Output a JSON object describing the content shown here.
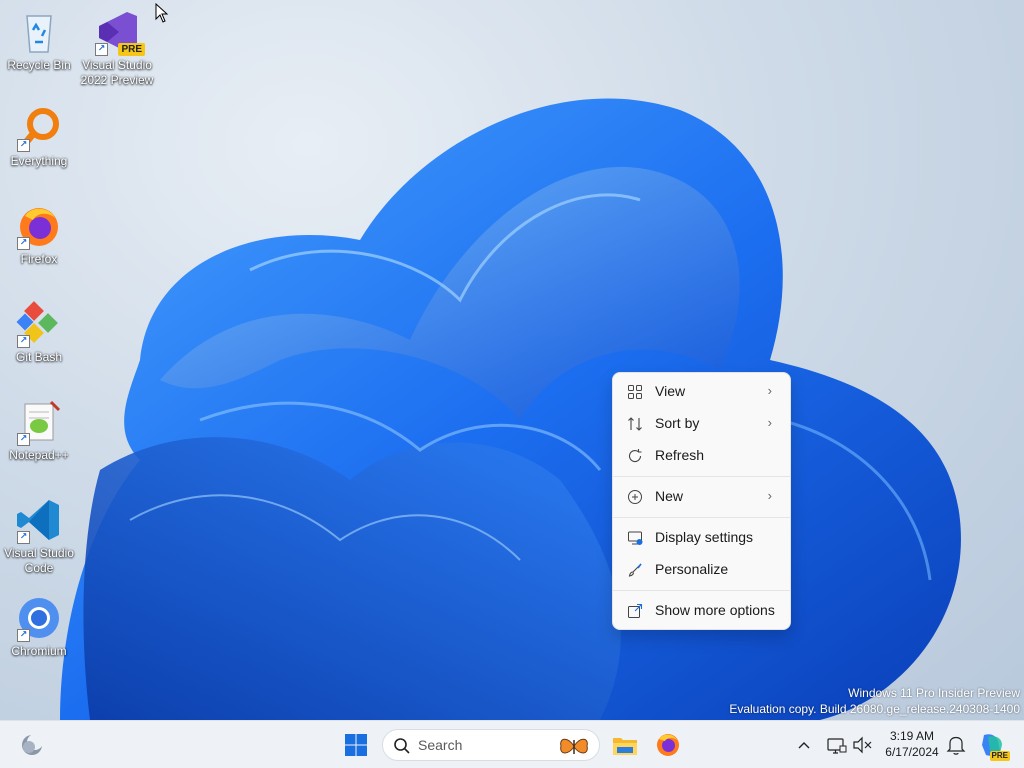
{
  "desktop": {
    "icons": [
      {
        "label": "Recycle Bin",
        "icon": "recycle-bin-icon"
      },
      {
        "label": "Visual Studio\n2022 Preview",
        "icon": "visual-studio-preview-icon",
        "badge": "PRE"
      },
      {
        "label": "Everything",
        "icon": "everything-search-icon"
      },
      {
        "label": "Firefox",
        "icon": "firefox-icon"
      },
      {
        "label": "Git Bash",
        "icon": "git-bash-icon"
      },
      {
        "label": "Notepad++",
        "icon": "notepad-plus-plus-icon"
      },
      {
        "label": "Visual Studio\nCode",
        "icon": "vscode-icon"
      },
      {
        "label": "Chromium",
        "icon": "chromium-icon"
      }
    ],
    "watermark": {
      "line1": "Windows 11 Pro Insider Preview",
      "line2": "Evaluation copy. Build 26080.ge_release.240308-1400"
    }
  },
  "context_menu": {
    "items": [
      {
        "label": "View",
        "icon": "grid-icon",
        "submenu": true
      },
      {
        "label": "Sort by",
        "icon": "sort-icon",
        "submenu": true
      },
      {
        "label": "Refresh",
        "icon": "refresh-icon",
        "submenu": false
      },
      {
        "label": "New",
        "icon": "plus-circle-icon",
        "submenu": true
      },
      {
        "label": "Display settings",
        "icon": "display-settings-icon",
        "submenu": false
      },
      {
        "label": "Personalize",
        "icon": "brush-icon",
        "submenu": false
      },
      {
        "label": "Show more options",
        "icon": "share-icon",
        "submenu": false
      }
    ],
    "chevron": "›"
  },
  "taskbar": {
    "search_placeholder": "Search",
    "time": "3:19 AM",
    "date": "6/17/2024",
    "pinned": [
      "start-icon",
      "search-icon",
      "file-explorer-icon",
      "firefox-icon"
    ],
    "tray": [
      "chevron-up-icon",
      "network-icon",
      "volume-icon",
      "notification-bell-icon",
      "copilot-icon"
    ],
    "copilot_badge": "PRE",
    "accent": "#1a6fe0"
  }
}
